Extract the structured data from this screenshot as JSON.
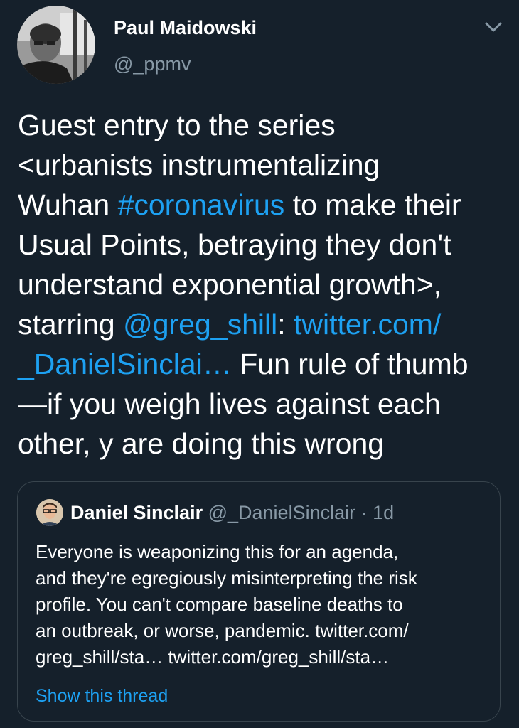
{
  "tweet": {
    "author": {
      "name": "Paul Maidowski",
      "handle": "@_ppmv",
      "avatar_icon": "profile-photo"
    },
    "menu_icon": "chevron-down-icon",
    "text": {
      "line1": "Guest entry to the series",
      "line2": "<urbanists instrumentalizing",
      "line3_pre": "Wuhan ",
      "line3_hashtag": "#coronavirus",
      "line3_post": " to make their",
      "line4": "Usual Points, betraying they don't",
      "line5": "understand exponential growth>,",
      "line6_pre": "starring ",
      "line6_mention": "@greg_shill",
      "line6_colon": ": ",
      "line6_link": "twitter.com/",
      "line7_link": "_DanielSinclai…",
      "line7_post": " Fun rule of thumb",
      "line8": "—if you weigh lives against each",
      "line9": "other, y are doing this wrong"
    }
  },
  "quoted_tweet": {
    "author": {
      "name": "Daniel Sinclair",
      "handle": "@_DanielSinclair",
      "separator": "·",
      "time": "1d"
    },
    "text": {
      "line1": "Everyone is weaponizing this for an agenda,",
      "line2": "and they're egregiously misinterpreting the risk",
      "line3": "profile. You can't compare baseline deaths to",
      "line4": "an outbreak, or worse, pandemic. twitter.com/",
      "line5": "greg_shill/sta… twitter.com/greg_shill/sta…"
    },
    "show_thread_label": "Show this thread"
  },
  "colors": {
    "background": "#15202b",
    "text": "#ffffff",
    "secondary_text": "#8899a6",
    "link": "#1da1f2",
    "border": "#38444d"
  }
}
